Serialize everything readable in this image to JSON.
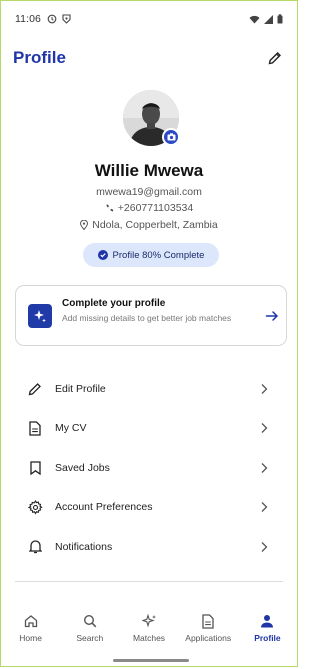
{
  "status_bar": {
    "time": "11:06",
    "left_icons": [
      "history-icon",
      "shield-icon"
    ],
    "right_icons": [
      "wifi-icon",
      "signal-icon",
      "battery-icon"
    ]
  },
  "header": {
    "title": "Profile",
    "edit_icon": "pencil-icon"
  },
  "profile": {
    "name": "Willie Mwewa",
    "email": "mwewa19@gmail.com",
    "phone": "+260771103534",
    "location": "Ndola, Copperbelt, Zambia",
    "completion_badge": "Profile 80% Complete",
    "completion_percent": 80
  },
  "complete_card": {
    "title": "Complete your profile",
    "subtitle": "Add missing details to get better job matches"
  },
  "menu": [
    {
      "label": "Edit Profile",
      "icon": "pencil-icon"
    },
    {
      "label": "My CV",
      "icon": "document-icon"
    },
    {
      "label": "Saved Jobs",
      "icon": "bookmark-icon"
    },
    {
      "label": "Account Preferences",
      "icon": "gear-icon"
    },
    {
      "label": "Notifications",
      "icon": "bell-icon"
    }
  ],
  "nav": [
    {
      "label": "Home",
      "icon": "home-icon",
      "active": false
    },
    {
      "label": "Search",
      "icon": "search-icon",
      "active": false
    },
    {
      "label": "Matches",
      "icon": "sparkle-icon",
      "active": false
    },
    {
      "label": "Applications",
      "icon": "document-icon",
      "active": false
    },
    {
      "label": "Profile",
      "icon": "person-icon",
      "active": true
    }
  ],
  "colors": {
    "accent": "#1f35a8",
    "badge_bg": "#dde7fb",
    "card_icon_bg": "#203ba8",
    "frame_border": "#b7d96a"
  }
}
